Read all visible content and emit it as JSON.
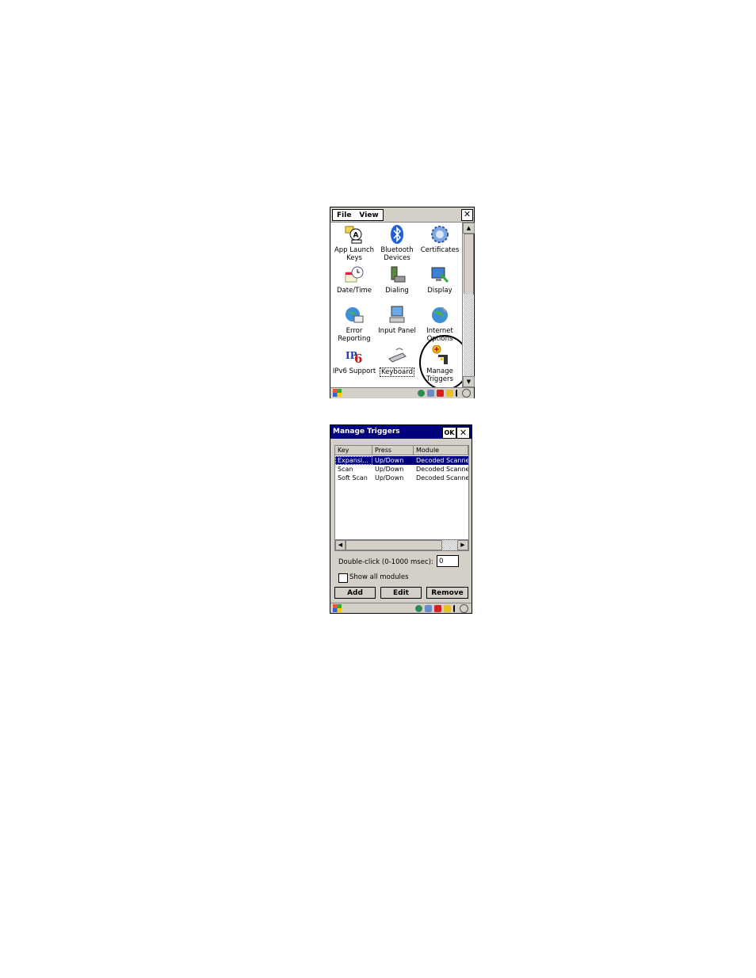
{
  "control_panel": {
    "menu": [
      "File",
      "View"
    ],
    "close_glyph": "✕",
    "scroll_up": "▲",
    "scroll_down": "▼",
    "items": [
      {
        "label": "App Launch Keys",
        "icon": "app-launch-keys-icon"
      },
      {
        "label": "Bluetooth Devices",
        "icon": "bluetooth-icon"
      },
      {
        "label": "Certificates",
        "icon": "certificates-icon"
      },
      {
        "label": "Date/Time",
        "icon": "date-time-icon"
      },
      {
        "label": "Dialing",
        "icon": "dialing-icon"
      },
      {
        "label": "Display",
        "icon": "display-icon"
      },
      {
        "label": "Error Reporting",
        "icon": "error-reporting-icon"
      },
      {
        "label": "Input Panel",
        "icon": "input-panel-icon"
      },
      {
        "label": "Internet Options",
        "icon": "internet-options-icon"
      },
      {
        "label": "IPv6 Support",
        "icon": "ipv6-icon"
      },
      {
        "label": "Keyboard",
        "icon": "keyboard-icon"
      },
      {
        "label": "Manage Triggers",
        "icon": "manage-triggers-icon"
      }
    ]
  },
  "manage_triggers": {
    "title": "Manage Triggers",
    "ok_label": "OK",
    "close_glyph": "✕",
    "columns": [
      "Key",
      "Press",
      "Module"
    ],
    "rows": [
      {
        "key": "Expansi...",
        "press": "Up/Down",
        "module": "Decoded Scanner",
        "selected": true
      },
      {
        "key": "Scan",
        "press": "Up/Down",
        "module": "Decoded Scanner",
        "selected": false
      },
      {
        "key": "Soft Scan",
        "press": "Up/Down",
        "module": "Decoded Scanner",
        "selected": false
      }
    ],
    "hscroll_left": "◀",
    "hscroll_right": "▶",
    "double_click_label": "Double-click (0-1000 msec):",
    "double_click_value": "0",
    "show_all_label": "Show all modules",
    "show_all_checked": false,
    "buttons": {
      "add": "Add",
      "edit": "Edit",
      "remove": "Remove"
    }
  },
  "colors": {
    "titlebar": "#000080",
    "selection": "#000080",
    "chrome": "#d4d0c8"
  }
}
